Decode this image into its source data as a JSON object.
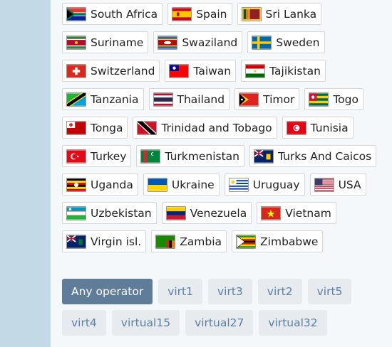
{
  "countries": [
    {
      "name": "South Africa",
      "flag": "south-africa-flag-icon"
    },
    {
      "name": "Spain",
      "flag": "spain-flag-icon"
    },
    {
      "name": "Sri Lanka",
      "flag": "sri-lanka-flag-icon"
    },
    {
      "name": "Suriname",
      "flag": "suriname-flag-icon"
    },
    {
      "name": "Swaziland",
      "flag": "swaziland-flag-icon"
    },
    {
      "name": "Sweden",
      "flag": "sweden-flag-icon"
    },
    {
      "name": "Switzerland",
      "flag": "switzerland-flag-icon"
    },
    {
      "name": "Taiwan",
      "flag": "taiwan-flag-icon"
    },
    {
      "name": "Tajikistan",
      "flag": "tajikistan-flag-icon"
    },
    {
      "name": "Tanzania",
      "flag": "tanzania-flag-icon"
    },
    {
      "name": "Thailand",
      "flag": "thailand-flag-icon"
    },
    {
      "name": "Timor",
      "flag": "timor-flag-icon"
    },
    {
      "name": "Togo",
      "flag": "togo-flag-icon"
    },
    {
      "name": "Tonga",
      "flag": "tonga-flag-icon"
    },
    {
      "name": "Trinidad and Tobago",
      "flag": "trinidad-and-tobago-flag-icon"
    },
    {
      "name": "Tunisia",
      "flag": "tunisia-flag-icon"
    },
    {
      "name": "Turkey",
      "flag": "turkey-flag-icon"
    },
    {
      "name": "Turkmenistan",
      "flag": "turkmenistan-flag-icon"
    },
    {
      "name": "Turks And Caicos",
      "flag": "turks-and-caicos-flag-icon"
    },
    {
      "name": "Uganda",
      "flag": "uganda-flag-icon"
    },
    {
      "name": "Ukraine",
      "flag": "ukraine-flag-icon"
    },
    {
      "name": "Uruguay",
      "flag": "uruguay-flag-icon"
    },
    {
      "name": "USA",
      "flag": "usa-flag-icon"
    },
    {
      "name": "Uzbekistan",
      "flag": "uzbekistan-flag-icon"
    },
    {
      "name": "Venezuela",
      "flag": "venezuela-flag-icon"
    },
    {
      "name": "Vietnam",
      "flag": "vietnam-flag-icon"
    },
    {
      "name": "Virgin isl.",
      "flag": "virgin-islands-flag-icon"
    },
    {
      "name": "Zambia",
      "flag": "zambia-flag-icon"
    },
    {
      "name": "Zimbabwe",
      "flag": "zimbabwe-flag-icon"
    }
  ],
  "operators": [
    {
      "label": "Any operator",
      "active": true
    },
    {
      "label": "virt1",
      "active": false
    },
    {
      "label": "virt3",
      "active": false
    },
    {
      "label": "virt2",
      "active": false
    },
    {
      "label": "virt5",
      "active": false
    },
    {
      "label": "virt4",
      "active": false
    },
    {
      "label": "virtual15",
      "active": false
    },
    {
      "label": "virtual27",
      "active": false
    },
    {
      "label": "virtual32",
      "active": false
    }
  ],
  "colors": {
    "page_background": "#c4d9e6",
    "panel_background": "#f5f8fb",
    "operator_active_bg": "#5f7d99",
    "operator_bg": "#e7ebef",
    "operator_text": "#5b7fa3"
  }
}
